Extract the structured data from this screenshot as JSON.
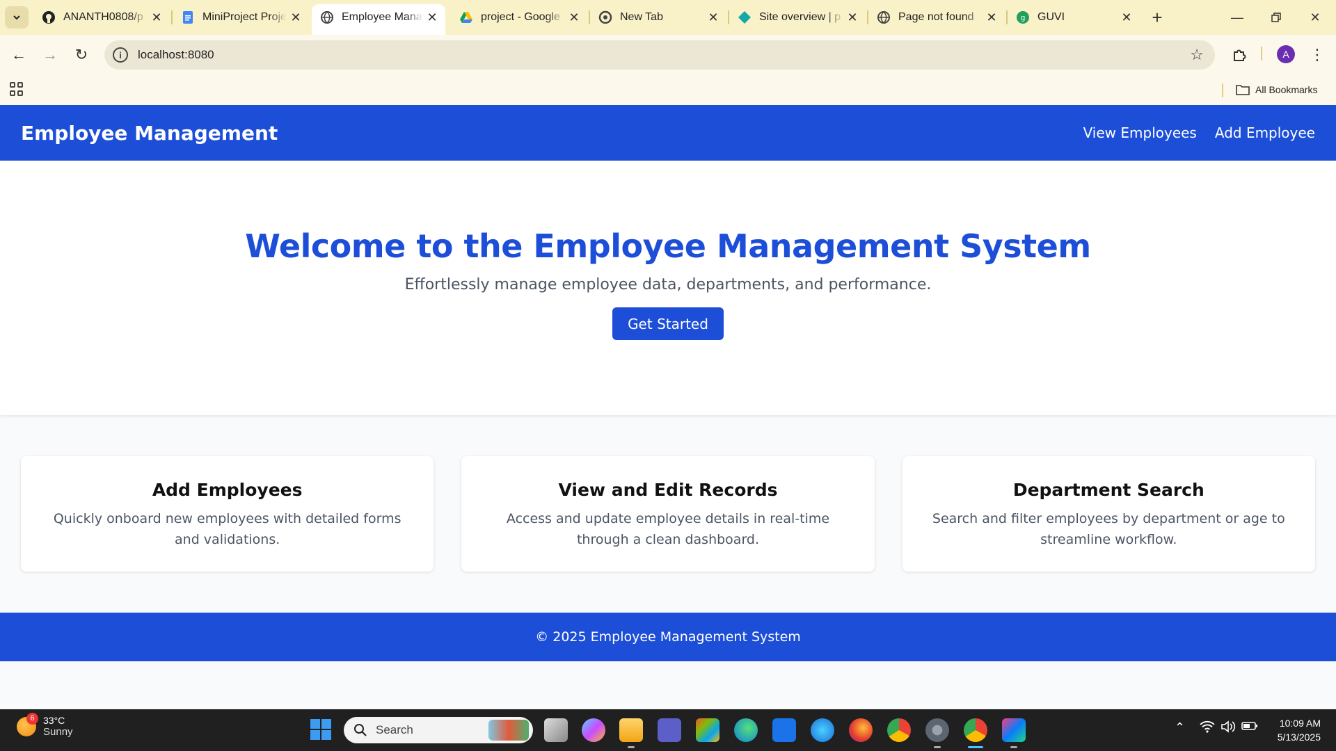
{
  "browser": {
    "tabs": [
      {
        "title": "ANANTH0808/p",
        "icon": "github-icon",
        "active": false
      },
      {
        "title": "MiniProject Proje",
        "icon": "google-docs-icon",
        "active": false
      },
      {
        "title": "Employee Manag",
        "icon": "globe-icon",
        "active": true
      },
      {
        "title": "project - Google",
        "icon": "google-drive-icon",
        "active": false
      },
      {
        "title": "New Tab",
        "icon": "chrome-icon",
        "active": false
      },
      {
        "title": "Site overview | p",
        "icon": "netlify-icon",
        "active": false
      },
      {
        "title": "Page not found",
        "icon": "globe-icon",
        "active": false
      },
      {
        "title": "GUVI",
        "icon": "guvi-icon",
        "active": false
      }
    ],
    "url": "localhost:8080",
    "profile_initial": "A",
    "bookmarks_label": "All Bookmarks"
  },
  "app": {
    "brand": "Employee Management",
    "nav": {
      "view": "View Employees",
      "add": "Add Employee"
    },
    "hero": {
      "title": "Welcome to the Employee Management System",
      "subtitle": "Effortlessly manage employee data, departments, and performance.",
      "cta": "Get Started"
    },
    "features": [
      {
        "title": "Add Employees",
        "text": "Quickly onboard new employees with detailed forms and validations."
      },
      {
        "title": "View and Edit Records",
        "text": "Access and update employee details in real-time through a clean dashboard."
      },
      {
        "title": "Department Search",
        "text": "Search and filter employees by department or age to streamline workflow."
      }
    ],
    "footer": "© 2025 Employee Management System",
    "colors": {
      "primary": "#1d4ed8",
      "text_muted": "#4b5563"
    }
  },
  "taskbar": {
    "weather": {
      "temp": "33°C",
      "condition": "Sunny",
      "badge": "6"
    },
    "search_placeholder": "Search",
    "time": "10:09 AM",
    "date": "5/13/2025"
  }
}
